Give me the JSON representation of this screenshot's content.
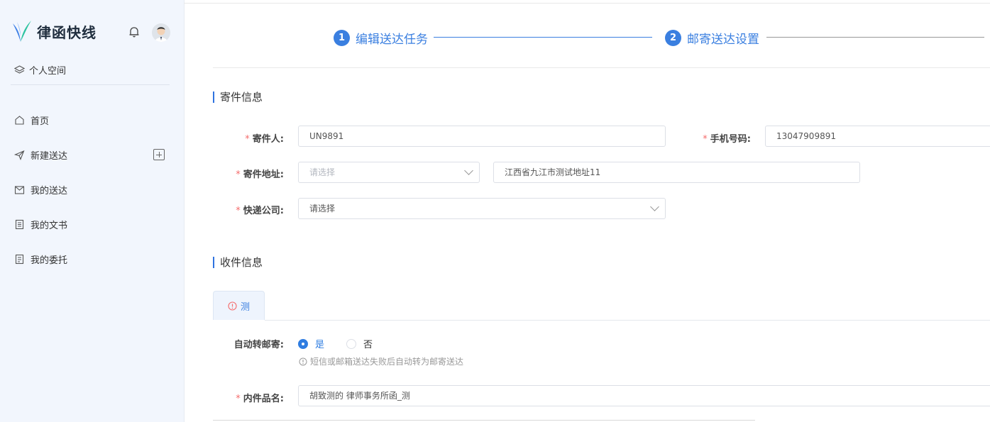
{
  "sidebar": {
    "brand": "律函快线",
    "space_label": "个人空间",
    "items": [
      {
        "label": "首页"
      },
      {
        "label": "新建送达"
      },
      {
        "label": "我的送达"
      },
      {
        "label": "我的文书"
      },
      {
        "label": "我的委托"
      }
    ]
  },
  "steps": [
    {
      "num": "1",
      "label": "编辑送达任务"
    },
    {
      "num": "2",
      "label": "邮寄送达设置"
    }
  ],
  "sender": {
    "section_title": "寄件信息",
    "sender_label": "寄件人:",
    "sender_value": "UN9891",
    "phone_label": "手机号码:",
    "phone_value": "13047909891",
    "address_label": "寄件地址:",
    "address_select_placeholder": "请选择",
    "address_detail": "江西省九江市测试地址11",
    "courier_label": "快递公司:",
    "courier_value": "请选择"
  },
  "receiver": {
    "section_title": "收件信息",
    "tab_label": "测",
    "auto_mail_label": "自动转邮寄:",
    "option_yes": "是",
    "option_no": "否",
    "hint": "短信或邮箱送达失败后自动转为邮寄送达",
    "item_name_label": "内件品名:",
    "item_name_value": "胡致测的 律师事务所函_测"
  },
  "colors": {
    "accent": "#3a7fe0",
    "required": "#f56c6c",
    "sidebar_bg": "#f2f6fd"
  }
}
